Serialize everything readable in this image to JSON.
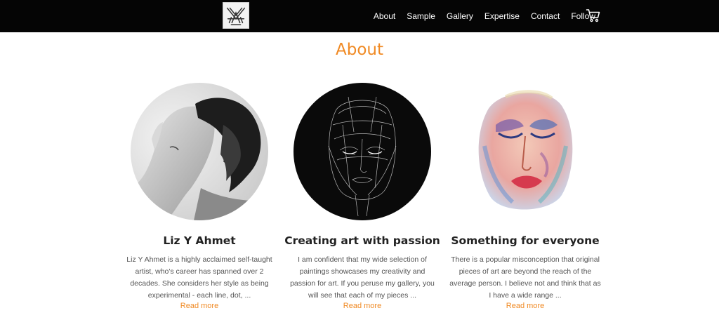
{
  "navbar": {
    "logo_icon": "liy-monogram-logo",
    "links": [
      "About",
      "Sample",
      "Gallery",
      "Expertise",
      "Contact",
      "Follow"
    ],
    "cart_icon": "shopping-cart-icon"
  },
  "page": {
    "heading": "About",
    "accent_color": "#f08a24"
  },
  "cards": [
    {
      "image": "artist-portrait-photo",
      "title": "Liz Y Ahmet",
      "text": "Liz Y Ahmet is a highly acclaimed self-taught artist, who's career has spanned over 2 decades. She considers her style as being experimental - each line, dot, ...",
      "link": "Read more"
    },
    {
      "image": "scribble-face-artwork",
      "title": "Creating art with passion",
      "text": "I am confident that my wide selection of paintings showcases my creativity and passion for art. If you peruse my gallery, you will see that each of my pieces ...",
      "link": "Read more"
    },
    {
      "image": "watercolor-face-artwork",
      "title": "Something for everyone",
      "text": "There is a popular misconception that original pieces of art are beyond the reach of the average person. I believe not and think that as I have a wide range ...",
      "link": "Read more"
    }
  ]
}
